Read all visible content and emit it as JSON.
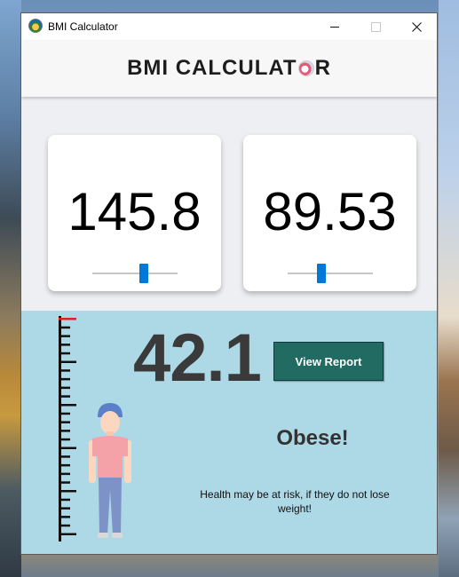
{
  "window": {
    "title": "BMI Calculator"
  },
  "header": {
    "title_prefix": "BMI CALCULAT",
    "title_suffix": "R"
  },
  "height_card": {
    "value": "145.8",
    "slider_fraction": 0.6
  },
  "weight_card": {
    "value": "89.53",
    "slider_fraction": 0.4
  },
  "result": {
    "bmi": "42.1",
    "report_button": "View Report",
    "status": "Obese!",
    "advice": "Health may be at risk, if they do not lose weight!"
  },
  "colors": {
    "accent_blue": "#0078d7",
    "report_button": "#216b63",
    "result_panel": "#add8e6",
    "ruler_marker": "#e02020"
  },
  "icons": {
    "app": "bmi-app-icon",
    "logo": "bmi-logo-icon"
  }
}
